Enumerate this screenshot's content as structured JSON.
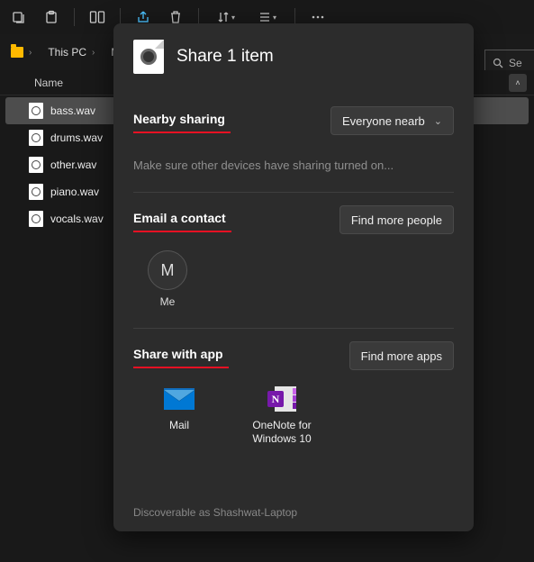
{
  "toolbar": {
    "icons": [
      "new-tab-icon",
      "paste-icon",
      "layout-icon",
      "share-icon",
      "delete-icon",
      "sort-icon",
      "view-icon",
      "more-icon"
    ]
  },
  "breadcrumb": {
    "root_label": "This PC",
    "folder_label": "Music"
  },
  "search": {
    "placeholder": "Se"
  },
  "columns": {
    "name": "Name"
  },
  "files": [
    {
      "name": "bass.wav",
      "selected": true
    },
    {
      "name": "drums.wav",
      "selected": false
    },
    {
      "name": "other.wav",
      "selected": false
    },
    {
      "name": "piano.wav",
      "selected": false
    },
    {
      "name": "vocals.wav",
      "selected": false
    }
  ],
  "share": {
    "title": "Share 1 item",
    "nearby": {
      "heading": "Nearby sharing",
      "dropdown": "Everyone nearb",
      "hint": "Make sure other devices have sharing turned on..."
    },
    "email": {
      "heading": "Email a contact",
      "button": "Find more people",
      "contact_initial": "M",
      "contact_name": "Me"
    },
    "apps": {
      "heading": "Share with app",
      "button": "Find more apps",
      "list": [
        {
          "name": "Mail"
        },
        {
          "name": "OneNote for Windows 10"
        }
      ]
    },
    "footer": "Discoverable as Shashwat-Laptop"
  }
}
